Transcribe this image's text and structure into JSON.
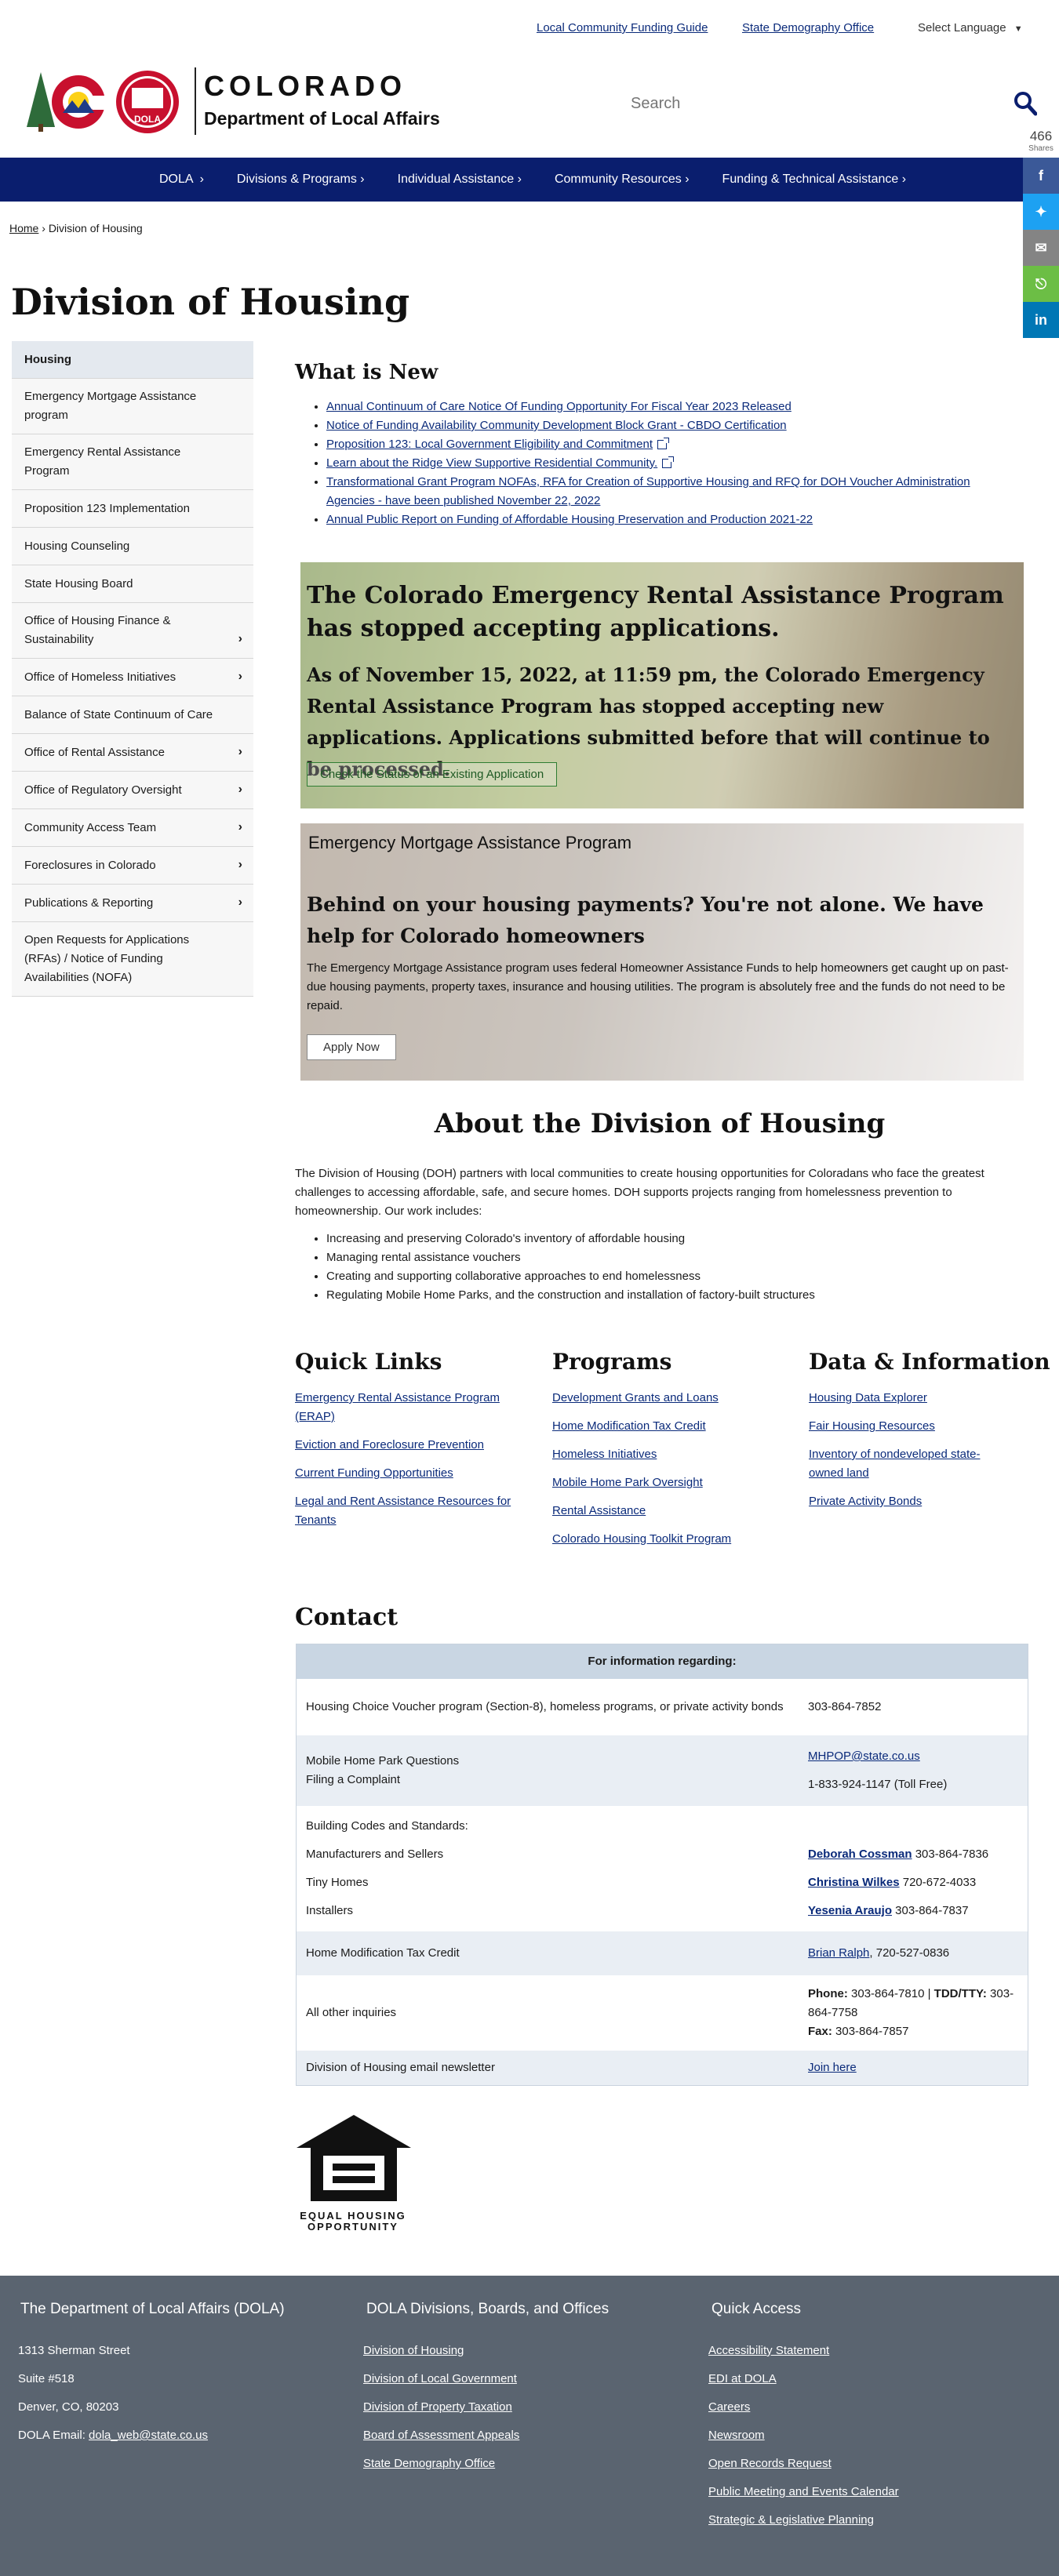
{
  "utility": {
    "link1": "Local Community Funding Guide",
    "link2": "State Demography Office",
    "language": "Select Language"
  },
  "logo": {
    "colorado": "COLORADO",
    "dept": "Department of Local Affairs",
    "badge": "DOLA"
  },
  "search": {
    "placeholder": "Search"
  },
  "shares": {
    "count": "466",
    "label": "Shares"
  },
  "nav": [
    "DOLA",
    "Divisions & Programs",
    "Individual Assistance",
    "Community Resources",
    "Funding & Technical Assistance"
  ],
  "breadcrumb": {
    "home": "Home",
    "current": "Division of Housing"
  },
  "page_title": "Division of Housing",
  "sidebar": [
    {
      "label": "Housing"
    },
    {
      "label": "Emergency Mortgage Assistance program"
    },
    {
      "label": "Emergency Rental Assistance Program"
    },
    {
      "label": "Proposition 123 Implementation"
    },
    {
      "label": "Housing Counseling"
    },
    {
      "label": "State Housing Board"
    },
    {
      "label": "Office of Housing Finance & Sustainability"
    },
    {
      "label": "Office of Homeless Initiatives"
    },
    {
      "label": "Balance of State Continuum of Care"
    },
    {
      "label": "Office of Rental Assistance"
    },
    {
      "label": "Office of Regulatory Oversight"
    },
    {
      "label": "Community Access Team"
    },
    {
      "label": "Foreclosures in Colorado"
    },
    {
      "label": "Publications & Reporting"
    },
    {
      "label": "Open Requests for Applications (RFAs) / Notice of Funding Availabilities (NOFA)"
    }
  ],
  "whats_new": {
    "title": "What is New",
    "items": [
      "Annual Continuum of Care Notice Of Funding Opportunity For Fiscal Year 2023 Released",
      "Notice of Funding Availability Community Development Block Grant - CBDO Certification",
      "Proposition 123: Local Government Eligibility and Commitment",
      "Learn about the Ridge View Supportive Residential Community.",
      "Transformational Grant Program NOFAs, RFA for Creation of Supportive Housing and RFQ for DOH Voucher Administration Agencies - have been published November 22, 2022",
      "Annual Public Report on Funding of Affordable Housing Preservation and Production 2021-22"
    ]
  },
  "erap_banner": {
    "heading": "The Colorado Emergency Rental Assistance Program has stopped accepting applications.",
    "body": "As of November 15, 2022, at 11:59 pm, the Colorado Emergency Rental Assistance Program has stopped accepting new applications. Applications submitted before that will continue to be processed.",
    "button": "Check the Status of an Existing Application"
  },
  "emap_banner": {
    "label": "Emergency Mortgage Assistance Program",
    "heading": "Behind on your housing payments? You're not alone. We have help for Colorado homeowners",
    "body": "The Emergency Mortgage Assistance program uses federal Homeowner Assistance Funds to help homeowners get caught up on past-due housing payments, property taxes, insurance and housing utilities. The program is absolutely free and the funds do not need to be repaid.",
    "button": "Apply Now"
  },
  "about": {
    "title": "About the Division of Housing",
    "intro": "The Division of Housing (DOH) partners with local communities to create housing opportunities for Coloradans who face the greatest challenges to accessing affordable, safe, and secure homes. DOH supports projects ranging from homelessness prevention to homeownership. Our work includes:",
    "items": [
      "Increasing and preserving Colorado's inventory of affordable housing",
      "Managing rental assistance vouchers",
      "Creating and supporting collaborative approaches to end homelessness",
      "Regulating Mobile Home Parks, and the construction and installation of factory-built structures"
    ]
  },
  "quick_links": {
    "title": "Quick Links",
    "items": [
      "Emergency Rental Assistance Program (ERAP)",
      "Eviction and Foreclosure Prevention",
      "Current Funding Opportunities",
      "Legal and Rent Assistance Resources for Tenants"
    ]
  },
  "programs": {
    "title": "Programs",
    "items": [
      "Development Grants and Loans",
      "Home Modification Tax Credit",
      "Homeless Initiatives",
      "Mobile Home Park Oversight",
      "Rental Assistance",
      "Colorado Housing Toolkit Program"
    ]
  },
  "data_info": {
    "title": "Data & Information",
    "items": [
      "Housing Data Explorer",
      "Fair Housing Resources",
      "Inventory of nondeveloped state-owned land",
      "Private Activity Bonds"
    ]
  },
  "contact": {
    "title": "Contact",
    "header": "For information regarding:",
    "r1_topic": "Housing Choice Voucher program (Section-8), homeless programs, or private activity bonds",
    "r1_phone": "303-864-7852",
    "r2_topic1": "Mobile Home Park Questions",
    "r2_topic2": "Filing a Complaint",
    "r2_email": "MHPOP@state.co.us",
    "r2_phone": "1-833-924-1147 (Toll Free)",
    "r3_head": "Building Codes and Standards:",
    "r3_a": "Manufacturers and Sellers",
    "r3_a_name": "Deborah Cossman",
    "r3_a_phone": " 303-864-7836",
    "r3_b": "Tiny Homes",
    "r3_b_name": "Christina Wilkes",
    "r3_b_phone": " 720-672-4033",
    "r3_c": "Installers",
    "r3_c_name": "Yesenia Araujo",
    "r3_c_phone": " 303-864-7837",
    "r4_topic": "Home Modification Tax Credit",
    "r4_name": "Brian Ralph",
    "r4_phone": ", 720-527-0836",
    "r5_topic": "All other inquiries",
    "r5_phone_label": "Phone:",
    "r5_phone": " 303-864-7810 | ",
    "r5_tdd_label": "TDD/TTY:",
    "r5_tdd": " 303-864-7758",
    "r5_fax_label": "Fax:",
    "r5_fax": " 303-864-7857",
    "r6_topic": "Division of Housing email newsletter",
    "r6_link": "Join here"
  },
  "eho": {
    "line1": "EQUAL HOUSING",
    "line2": "OPPORTUNITY"
  },
  "footer": {
    "col1_title": "The Department of Local Affairs (DOLA)",
    "addr1": "1313 Sherman Street",
    "addr2": "Suite  #518",
    "addr3": "Denver, CO, 80203",
    "email_label": "DOLA Email: ",
    "email": "dola_web@state.co.us",
    "col2_title": "DOLA Divisions, Boards, and Offices",
    "col2_items": [
      "Division of Housing",
      "Division of Local Government",
      "Division of Property Taxation",
      "Board of Assessment Appeals",
      "State Demography Office"
    ],
    "col3_title": "Quick Access",
    "col3_items": [
      "Accessibility Statement",
      "EDI at DOLA",
      "Careers",
      "Newsroom",
      "Open Records Request",
      "Public Meeting and Events Calendar",
      "Strategic & Legislative Planning"
    ]
  },
  "colors": {
    "nav": "#0a1e6e",
    "footer": "#5a6470",
    "link": "#0a2a7a"
  }
}
